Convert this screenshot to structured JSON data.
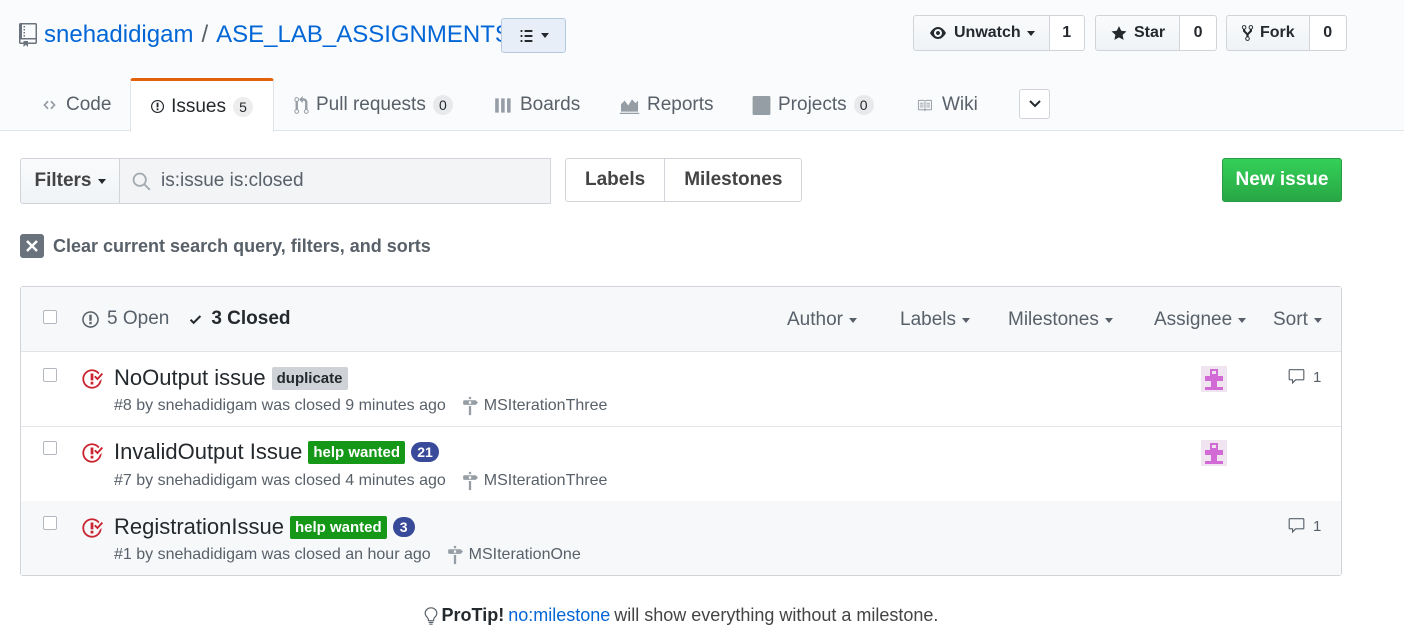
{
  "repo": {
    "owner": "snehadidigam",
    "separator": "/",
    "name": "ASE_LAB_ASSIGNMENTS"
  },
  "actions": {
    "watch": {
      "label": "Unwatch",
      "count": "1"
    },
    "star": {
      "label": "Star",
      "count": "0"
    },
    "fork": {
      "label": "Fork",
      "count": "0"
    }
  },
  "tabs": [
    {
      "label": "Code",
      "icon": "code-icon"
    },
    {
      "label": "Issues",
      "icon": "issue-opened-icon",
      "count": "5",
      "selected": true
    },
    {
      "label": "Pull requests",
      "icon": "git-pull-request-icon",
      "count": "0"
    },
    {
      "label": "Boards",
      "icon": "boards-icon"
    },
    {
      "label": "Reports",
      "icon": "graph-icon"
    },
    {
      "label": "Projects",
      "icon": "project-icon",
      "count": "0"
    },
    {
      "label": "Wiki",
      "icon": "book-icon"
    }
  ],
  "filters": {
    "filters_label": "Filters",
    "search_value": "is:issue is:closed",
    "labels_label": "Labels",
    "milestones_label": "Milestones",
    "new_issue_label": "New issue",
    "clear_label": "Clear current search query, filters, and sorts"
  },
  "list_header": {
    "open_label": "5 Open",
    "closed_label": "3 Closed",
    "author": "Author",
    "labels": "Labels",
    "milestones": "Milestones",
    "assignee": "Assignee",
    "sort": "Sort"
  },
  "issues": [
    {
      "title": "NoOutput issue",
      "labels": [
        {
          "name": "duplicate",
          "color": "#cfd3d7"
        }
      ],
      "badge": "",
      "meta": "#8 by snehadidigam was closed 9 minutes ago",
      "milestone": "MSIterationThree",
      "has_assignee": true,
      "comments": "1"
    },
    {
      "title": "InvalidOutput Issue",
      "labels": [
        {
          "name": "help wanted",
          "color": "#159818"
        }
      ],
      "badge": "21",
      "meta": "#7 by snehadidigam was closed 4 minutes ago",
      "milestone": "MSIterationThree",
      "has_assignee": true,
      "comments": ""
    },
    {
      "title": "RegistrationIssue",
      "labels": [
        {
          "name": "help wanted",
          "color": "#159818"
        }
      ],
      "badge": "3",
      "meta": "#1 by snehadidigam was closed an hour ago",
      "milestone": "MSIterationOne",
      "has_assignee": false,
      "comments": "1"
    }
  ],
  "protip": {
    "prefix": "ProTip!",
    "link": "no:milestone",
    "suffix": "will show everything without a milestone."
  },
  "colors": {
    "link": "#0366d6",
    "accent_tab": "#e36209",
    "new_issue": "#28a745",
    "closed_icon": "#cb2431",
    "avatar": "#d26ad6"
  }
}
